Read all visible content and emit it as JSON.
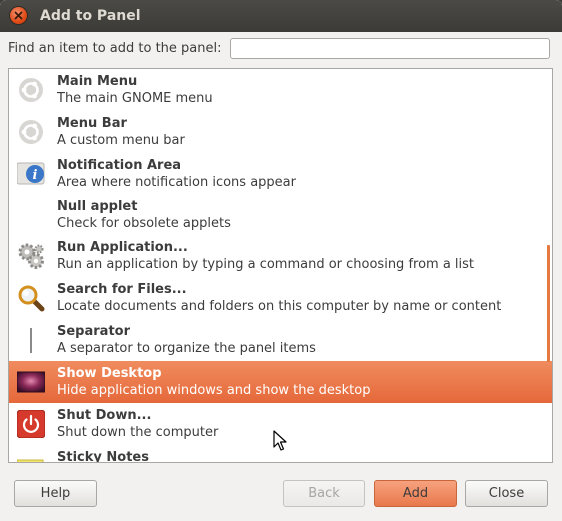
{
  "window": {
    "title": "Add to Panel"
  },
  "search": {
    "label": "Find an item to add to the panel:",
    "value": "",
    "placeholder": ""
  },
  "items": [
    {
      "name": "Main Menu",
      "desc": "The main GNOME menu",
      "icon": "ubuntu-logo-icon"
    },
    {
      "name": "Menu Bar",
      "desc": "A custom menu bar",
      "icon": "ubuntu-logo-icon"
    },
    {
      "name": "Notification Area",
      "desc": "Area where notification icons appear",
      "icon": "info-icon"
    },
    {
      "name": "Null applet",
      "desc": "Check for obsolete applets",
      "icon": ""
    },
    {
      "name": "Run Application...",
      "desc": "Run an application by typing a command or choosing from a list",
      "icon": "gears-icon"
    },
    {
      "name": "Search for Files...",
      "desc": "Locate documents and folders on this computer by name or content",
      "icon": "magnifier-icon"
    },
    {
      "name": "Separator",
      "desc": "A separator to organize the panel items",
      "icon": "separator-icon"
    },
    {
      "name": "Show Desktop",
      "desc": "Hide application windows and show the desktop",
      "icon": "desktop-icon",
      "selected": true
    },
    {
      "name": "Shut Down...",
      "desc": "Shut down the computer",
      "icon": "power-icon"
    },
    {
      "name": "Sticky Notes",
      "desc": "",
      "icon": "sticky-notes-icon"
    }
  ],
  "buttons": {
    "help": "Help",
    "back": "Back",
    "add": "Add",
    "close": "Close"
  },
  "colors": {
    "selection": "#e9703f",
    "titlebar": "#3c3b37",
    "close_button": "#df4a16"
  }
}
